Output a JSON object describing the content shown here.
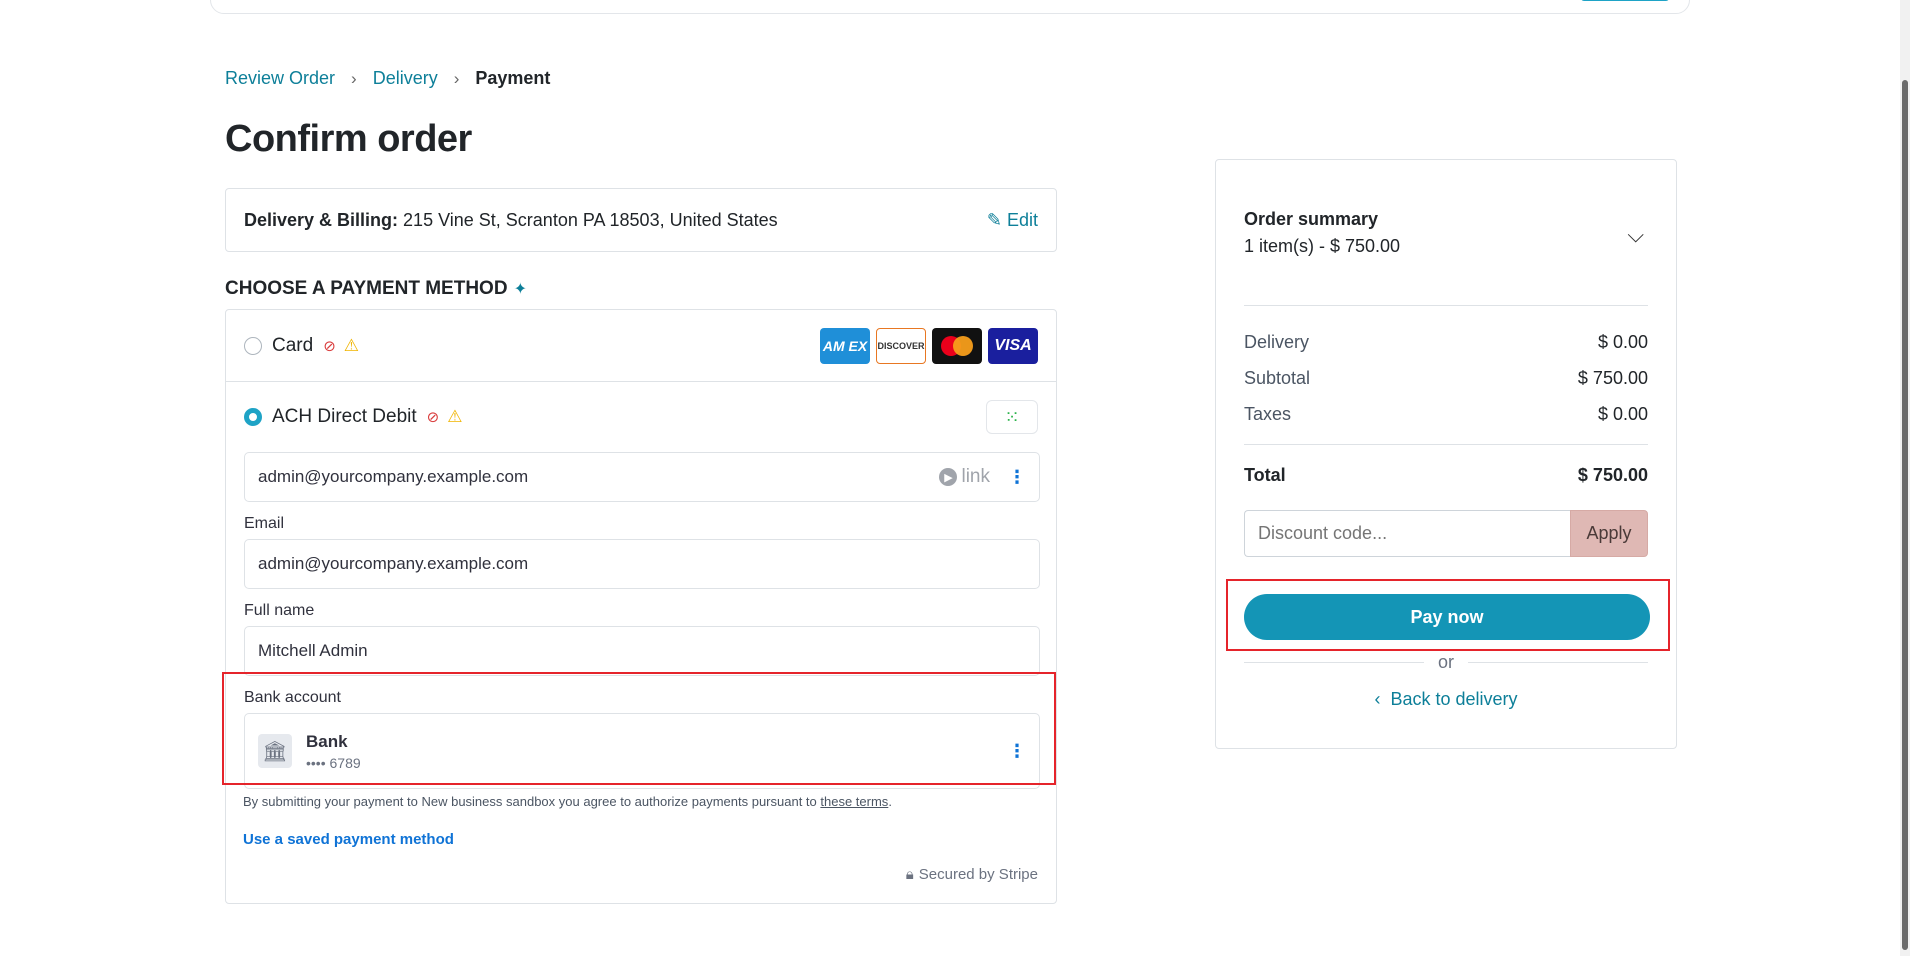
{
  "breadcrumb": {
    "step1": "Review Order",
    "step2": "Delivery",
    "current": "Payment"
  },
  "page_title": "Confirm order",
  "address": {
    "label": "Delivery & Billing:",
    "value": "215 Vine St, Scranton PA 18503, United States",
    "edit_label": "Edit"
  },
  "payment": {
    "heading": "CHOOSE A PAYMENT METHOD",
    "card": {
      "label": "Card",
      "logos": [
        "AM EX",
        "DISCOVER",
        "",
        "VISA"
      ]
    },
    "ach": {
      "label": "ACH Direct Debit",
      "link_email": "admin@yourcompany.example.com",
      "link_badge": "link",
      "email_label": "Email",
      "email_value": "admin@yourcompany.example.com",
      "name_label": "Full name",
      "name_value": "Mitchell Admin",
      "bank_label": "Bank account",
      "bank_name": "Bank",
      "bank_mask": "•••• 6789"
    },
    "terms_text": "By submitting your payment to New business sandbox you agree to authorize payments pursuant to",
    "terms_link": "these terms",
    "saved_method": "Use a saved payment method",
    "secured": "Secured by Stripe"
  },
  "summary": {
    "title": "Order summary",
    "items": "1 item(s) -  $ 750.00",
    "lines": [
      {
        "label": "Delivery",
        "value": "$ 0.00"
      },
      {
        "label": "Subtotal",
        "value": "$ 750.00"
      },
      {
        "label": "Taxes",
        "value": "$ 0.00"
      }
    ],
    "total_label": "Total",
    "total_value": "$ 750.00",
    "discount_placeholder": "Discount code...",
    "apply_label": "Apply",
    "pay_label": "Pay now",
    "or_label": "or",
    "back_label": "Back to delivery"
  },
  "colors": {
    "accent": "#1495b6",
    "link": "#0d7f99",
    "highlight": "#e5242b",
    "apply_bg": "#dfb8b4"
  }
}
